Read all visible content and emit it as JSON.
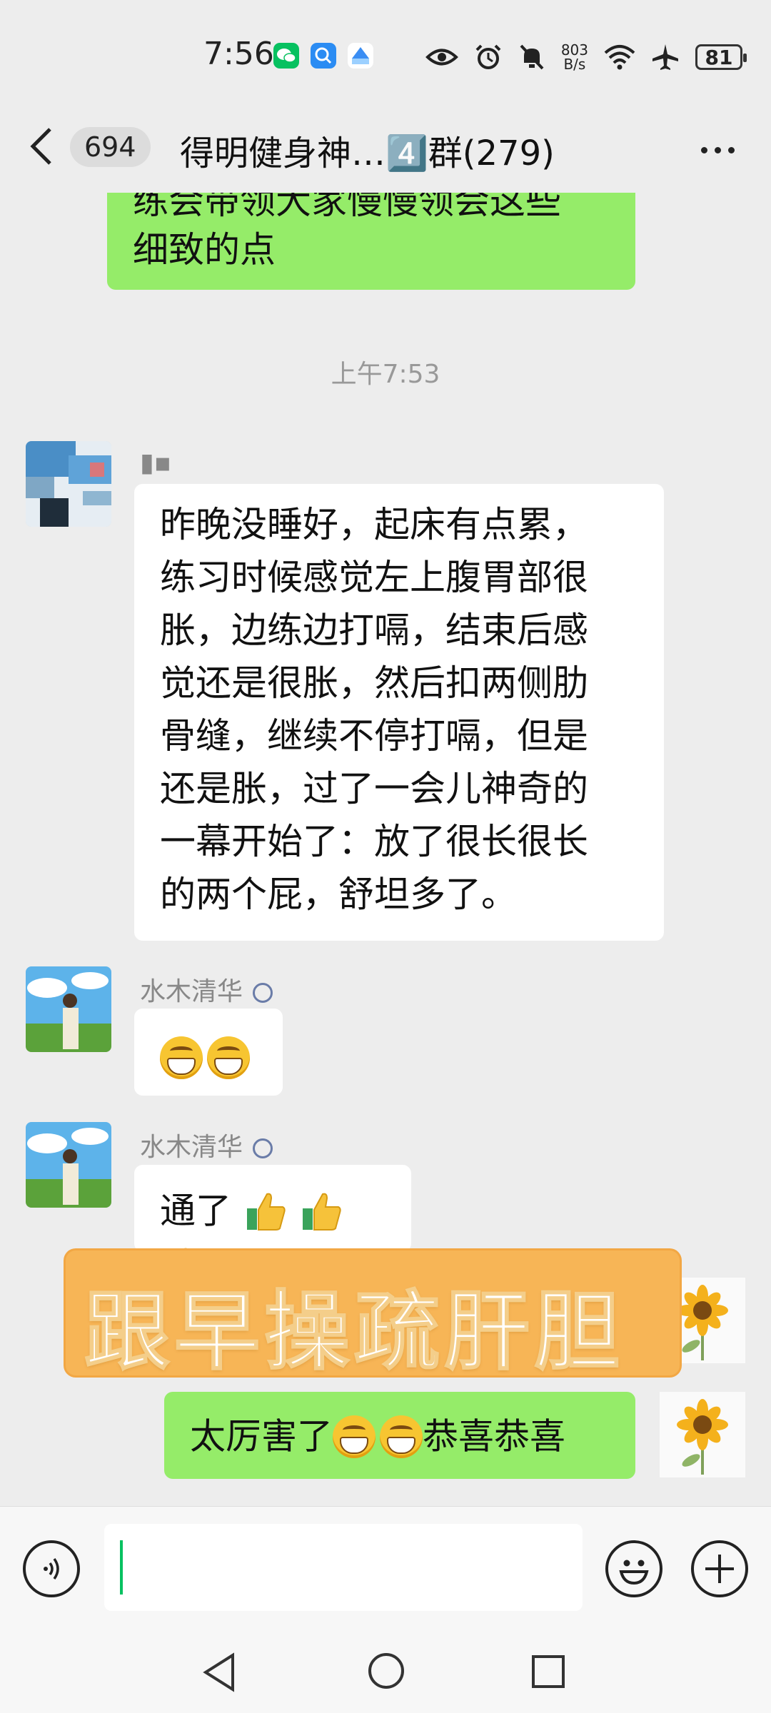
{
  "status_bar": {
    "time": "7:56",
    "net_speed_value": "803",
    "net_speed_unit": "B/s",
    "battery": "81"
  },
  "header": {
    "unread_count": "694",
    "title": "得明健身神…4️⃣群(279)"
  },
  "messages": {
    "prev_self_text_line1": "练会带领大家慢慢领会这些",
    "prev_self_text_line2": "细致的点",
    "timestamp": "上午7:53",
    "msg1_sender": "▮▪",
    "msg1_lines": [
      "昨晚没睡好，起床有点累，",
      "练习时候感觉左上腹胃部很",
      "胀，边练边打嗝，结束后感",
      "觉还是很胀，然后扣两侧肋",
      "骨缝，继续不停打嗝，但是",
      "还是胀，过了一会儿神奇的",
      "一幕开始了：放了很长很长",
      "的两个屁，舒坦多了。"
    ],
    "msg2_sender": "水木清华",
    "msg3_sender": "水木清华",
    "msg3_text": "通了",
    "self_msg_prefix": "太厉害了",
    "self_msg_suffix": "恭喜恭喜"
  },
  "overlay": {
    "banner_text": "跟早操疏肝胆"
  },
  "colors": {
    "self_bubble": "#95ec69",
    "other_bubble": "#ffffff",
    "background": "#ededed",
    "banner": "#f7b556"
  },
  "icons": {
    "back": "chevron-left-icon",
    "more": "more-dots-icon",
    "voice": "voice-icon",
    "emoji": "emoji-icon",
    "plus": "plus-icon"
  }
}
